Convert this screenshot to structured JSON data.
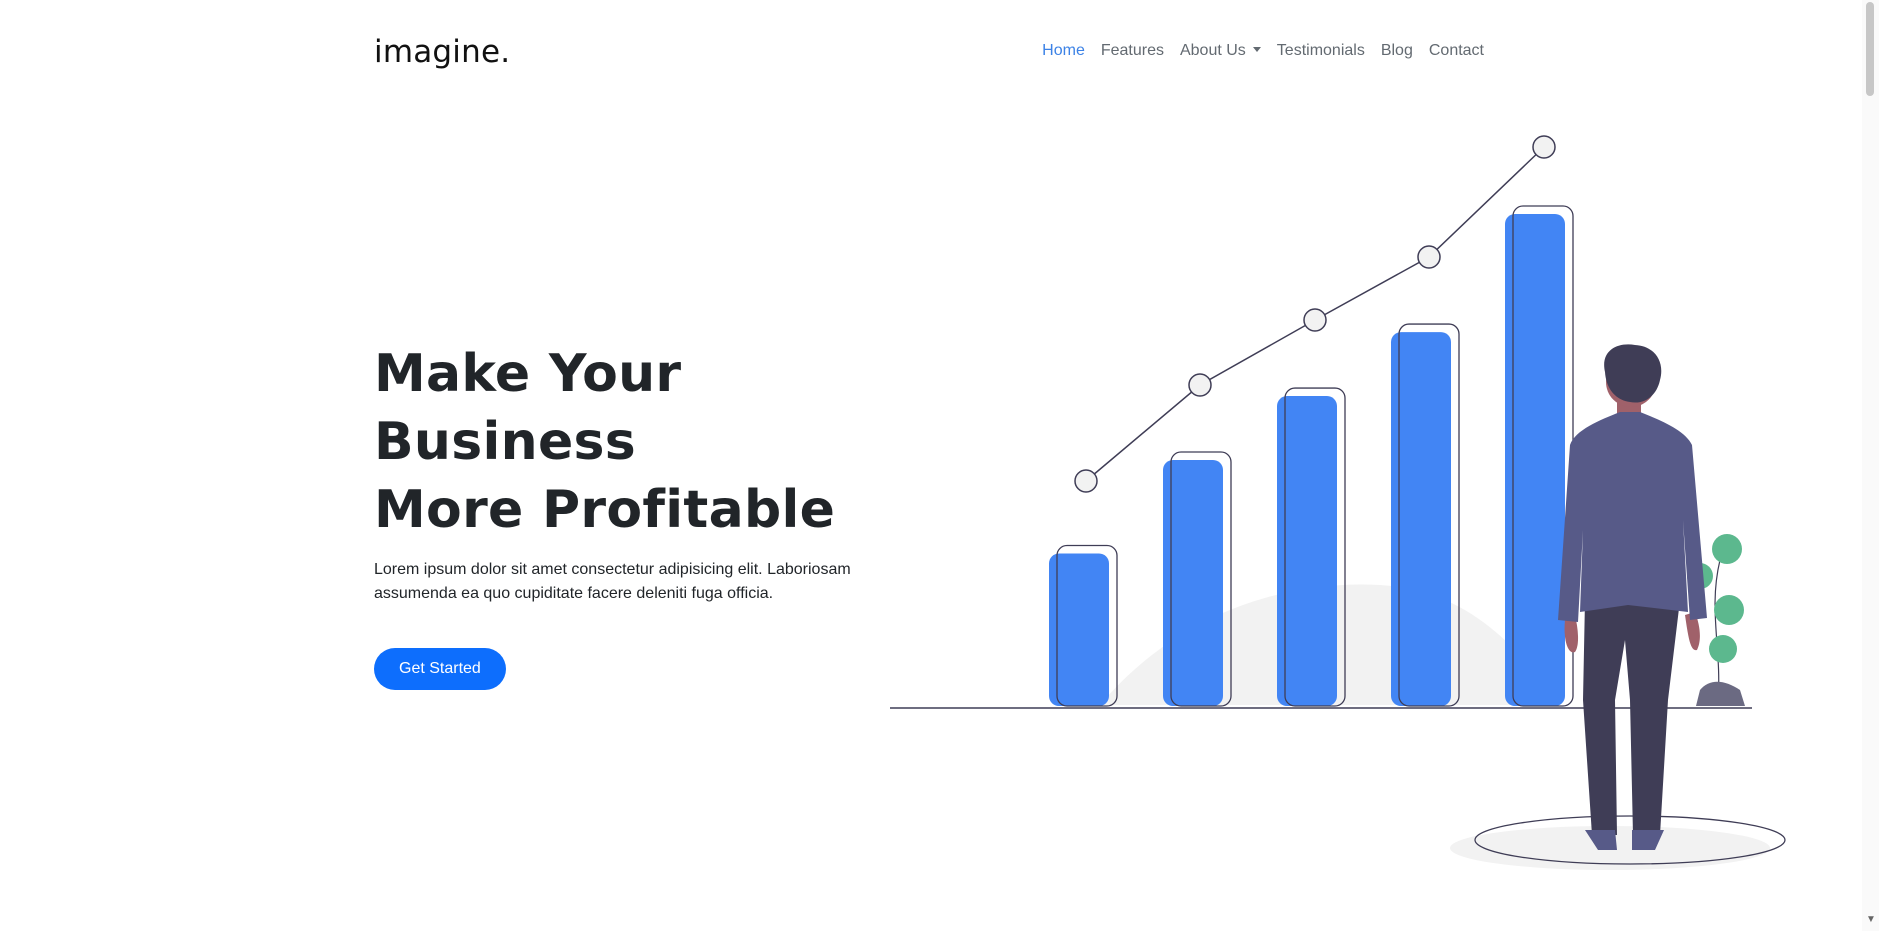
{
  "brand": {
    "name": "imagine."
  },
  "nav": {
    "items": [
      {
        "label": "Home",
        "active": true
      },
      {
        "label": "Features",
        "active": false
      },
      {
        "label": "About Us",
        "active": false,
        "dropdown": true
      },
      {
        "label": "Testimonials",
        "active": false
      },
      {
        "label": "Blog",
        "active": false
      },
      {
        "label": "Contact",
        "active": false
      }
    ]
  },
  "hero": {
    "title_line1": "Make Your Business",
    "title_line2": "More Profitable",
    "description": "Lorem ipsum dolor sit amet consectetur adipisicing elit. Laboriosam assumenda ea quo cupiditate facere deleniti fuga officia.",
    "cta_label": "Get Started"
  },
  "colors": {
    "accent": "#0d6efd",
    "nav_active": "#3c82e6",
    "bar_fill": "#4285f4",
    "suit": "#575a88",
    "pants": "#3f3d56",
    "plant": "#5cb88e"
  },
  "illustration": {
    "bar_levels": [
      0.31,
      0.5,
      0.63,
      0.76,
      1.0
    ],
    "icons": [
      "growth-chart-illustration",
      "businessman-illustration",
      "plant-illustration"
    ]
  }
}
